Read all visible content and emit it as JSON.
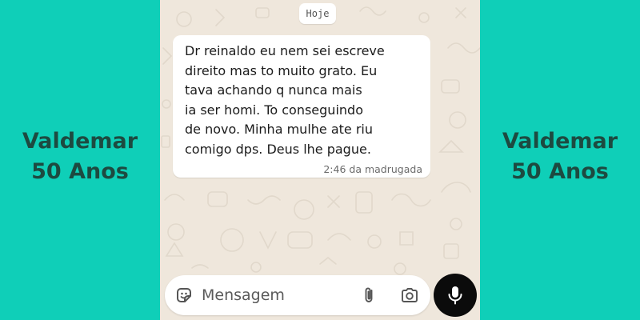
{
  "caption": {
    "left": {
      "name": "Valdemar",
      "age": "50 Anos"
    },
    "right": {
      "name": "Valdemar",
      "age": "50 Anos"
    }
  },
  "chat": {
    "day_label": "Hoje",
    "message": {
      "text": "Dr reinaldo eu nem sei escreve\ndireito mas to muito grato. Eu\ntava achando q nunca mais\nia ser homi. To conseguindo\nde novo. Minha mulhe ate riu\ncomigo dps. Deus lhe pague.",
      "time": "2:46 da madrugada"
    }
  },
  "composer": {
    "placeholder": "Mensagem",
    "icons": {
      "emoji": "emoji-sticker-icon",
      "attach": "paperclip-icon",
      "camera": "camera-icon",
      "mic": "microphone-icon"
    }
  },
  "colors": {
    "side_background": "#0fcfb8",
    "caption_text": "#1d4a40",
    "chat_wallpaper": "#efe7dc",
    "bubble": "#ffffff",
    "mic_button": "#0b0b0b"
  }
}
